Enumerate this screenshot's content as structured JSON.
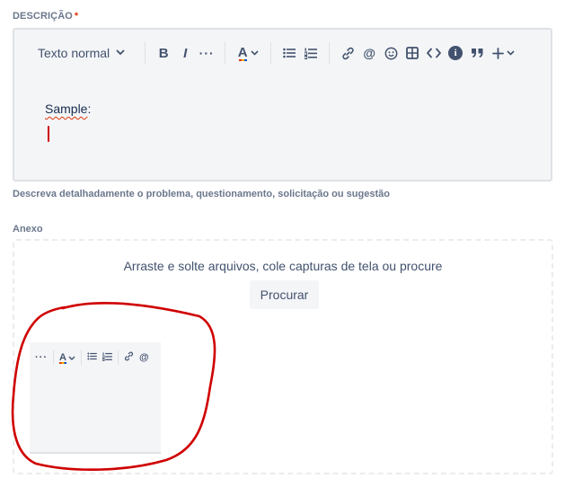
{
  "description_field": {
    "label": "DESCRIÇÃO",
    "required_mark": "*",
    "helper_text": "Descreva detalhadamente o problema, questionamento, solicitação ou sugestão"
  },
  "editor": {
    "toolbar": {
      "text_style": "Texto normal",
      "text_style_chevron": "⌄",
      "bold": "B",
      "italic": "I",
      "more": "···",
      "text_color": "A",
      "bullet_list": "☰",
      "numbered_list": "☷",
      "link": "🔗",
      "mention": "@",
      "emoji": "☺",
      "table": "⊞",
      "code": "<>",
      "info": "i",
      "quote": "❞",
      "insert": "+",
      "insert_chevron": "⌄"
    },
    "content": {
      "word": "Sample",
      "suffix": ":"
    }
  },
  "attachment": {
    "label": "Anexo",
    "drop_text": "Arraste e solte arquivos, cole capturas de tela ou procure",
    "browse_button": "Procurar"
  },
  "thumbnail": {
    "more": "···",
    "text_color": "A",
    "bullet_list": "☰",
    "numbered_list": "☷",
    "link": "🔗",
    "mention": "@"
  },
  "colors": {
    "annotation_red": "#d00000",
    "label_gray": "#6b778c",
    "required_red": "#de350b",
    "editor_bg": "#f4f5f7",
    "border": "#dfe1e6"
  }
}
